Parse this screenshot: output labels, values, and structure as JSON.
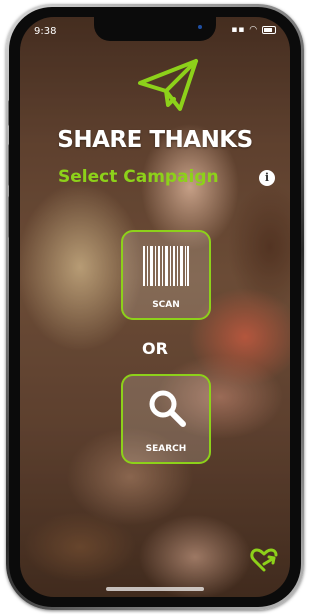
{
  "status_bar": {
    "time": "9:38"
  },
  "header": {
    "title": "SHARE THANKS",
    "subtitle": "Select Campaign",
    "info_glyph": "i"
  },
  "actions": {
    "scan_label": "SCAN",
    "or_label": "OR",
    "search_label": "SEARCH"
  },
  "icons": {
    "logo": "paper-plane-icon",
    "scan": "barcode-icon",
    "search": "search-icon",
    "info": "info-icon",
    "footer": "heart-share-icon"
  },
  "colors": {
    "accent": "#8dd11a",
    "text": "#ffffff"
  }
}
